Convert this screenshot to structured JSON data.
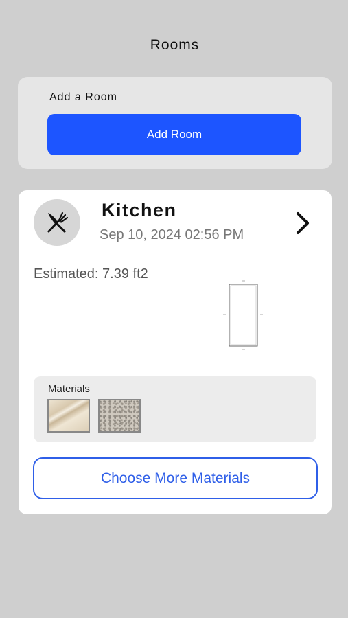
{
  "header": {
    "title": "Rooms"
  },
  "add_room": {
    "label": "Add a Room",
    "button_label": "Add Room",
    "button_color": "#1d55ff"
  },
  "room": {
    "icon": "fork-knife-icon",
    "name": "Kitchen",
    "date": "Sep 10, 2024 02:56 PM",
    "estimate": "Estimated: 7.39 ft2",
    "materials": {
      "label": "Materials",
      "swatches": [
        {
          "name": "beige-marble-swatch"
        },
        {
          "name": "granite-swatch"
        }
      ]
    },
    "choose_more_label": "Choose More Materials",
    "accent_color": "#2f5fe8"
  }
}
